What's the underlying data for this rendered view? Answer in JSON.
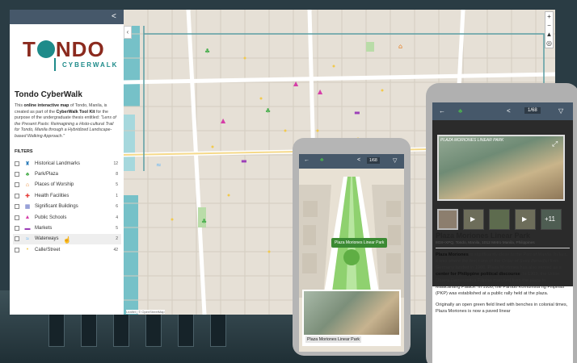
{
  "sidebar": {
    "logo_text_pre": "T",
    "logo_text_post": "NDO",
    "logo_sub": "CYBERWALK",
    "title": "Tondo CyberWalk",
    "desc_1": "This ",
    "desc_bold_1": "online interactive map",
    "desc_2": " of Tondo, Manila, is created as part of the ",
    "desc_bold_2": "CyberWalk Tool Kit",
    "desc_3": " for the purpose of the undergraduate thesis entitled: ",
    "desc_italic": "\"Lens of the Present Pasts: Reimagining a Histo-cultural Trail for Tondo, Manila through a Hybridized Landscape-based Walking Approach.\"",
    "filters_title": "FILTERS",
    "filters": [
      {
        "label": "Historical Landmarks",
        "count": "12",
        "icon": "landmark-icon",
        "color": "#2b7bb9",
        "glyph": "♜"
      },
      {
        "label": "Park/Plaza",
        "count": "8",
        "icon": "tree-icon",
        "color": "#4caf50",
        "glyph": "♣"
      },
      {
        "label": "Places of Worship",
        "count": "5",
        "icon": "church-icon",
        "color": "#e67e22",
        "glyph": "⌂"
      },
      {
        "label": "Health Facilities",
        "count": "1",
        "icon": "hospital-icon",
        "color": "#e53935",
        "glyph": "✚"
      },
      {
        "label": "Significant Buildings",
        "count": "6",
        "icon": "building-icon",
        "color": "#5e6bc0",
        "glyph": "▦"
      },
      {
        "label": "Public Schools",
        "count": "4",
        "icon": "school-icon",
        "color": "#d63ea8",
        "glyph": "▲"
      },
      {
        "label": "Markets",
        "count": "5",
        "icon": "market-icon",
        "color": "#9c3fb8",
        "glyph": "▬"
      },
      {
        "label": "Waterways",
        "count": "2",
        "icon": "water-icon",
        "color": "#64b5f6",
        "glyph": "≈"
      },
      {
        "label": "Calle/Street",
        "count": "42",
        "icon": "street-icon",
        "color": "#f2c94c",
        "glyph": "•"
      }
    ]
  },
  "map": {
    "zoom_in": "+",
    "zoom_out": "−",
    "north": "▲",
    "locate": "◎",
    "attribution": "Leaflet | © OpenStreetMap"
  },
  "phone1": {
    "count": "1/68",
    "map_label": "Plaza Moriones Linear Park",
    "card_title": "Plaza Moriones Linear Park"
  },
  "phone2": {
    "count": "1/68",
    "image_caption": "PLAZA MORIONES LINEAR PARK",
    "more_label": "+11",
    "name": "Plaza Moriones Linear Park",
    "address": "8G8+XPQ, Tondo, Manila, 1012 Metro Manila, Philippines",
    "p1_b1": "Plaza Moriones",
    "p1_t1": " is significantly close to the ",
    "p1_i1": "Port of Manila",
    "p1_t2": ". In fact, it was where the first nuns of the ",
    "p1_i2": "Order of Saint Benedict",
    "p1_t3": " from Germany landed in 1906. Plaza Moriones has also served as a ",
    "p1_b2": "center for Philippine political discourse",
    "p1_t4": ". In 1903, the Union Obrera Democratica Filipina marched from the plaza to Malacañang Palace. In 1930, the Partido Komunista ng Pilipinas (PKP) was established at a public rally held at the plaza.",
    "p2": "Originally an open green field lined with benches in colonial times, Plaza Moriones is now a paved linear"
  },
  "colors": {
    "topbar": "#46586a",
    "park_green": "#3b8a33",
    "brand_red": "#8b2a1e",
    "brand_teal": "#1e8b8a"
  }
}
